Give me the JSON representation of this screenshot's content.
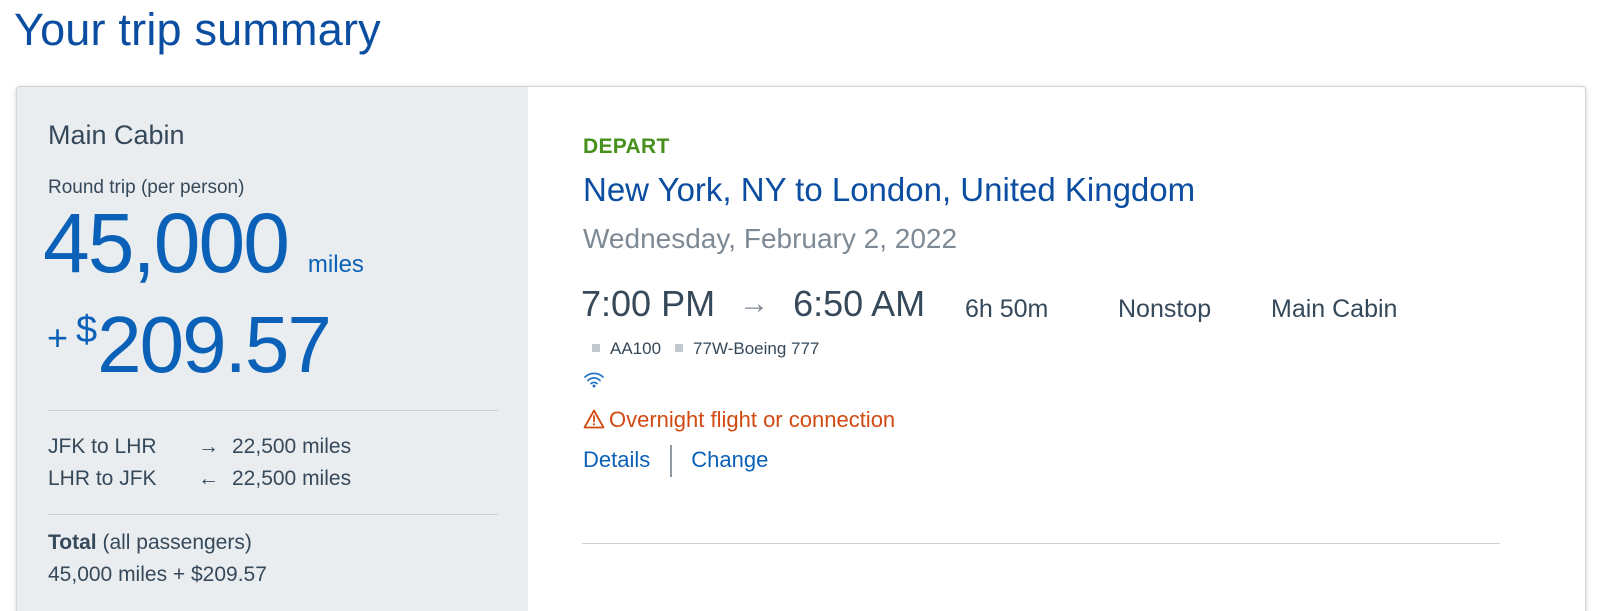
{
  "page": {
    "title": "Your trip summary"
  },
  "summary": {
    "cabin": "Main Cabin",
    "trip_type": "Round trip (per person)",
    "miles_amount": "45,000",
    "miles_unit": "miles",
    "price_plus": "+",
    "price_currency": "$",
    "price_amount": "209.57",
    "segments": [
      {
        "route": "JFK to LHR",
        "arrow": "→",
        "miles": "22,500 miles"
      },
      {
        "route": "LHR to JFK",
        "arrow": "←",
        "miles": "22,500 miles"
      }
    ],
    "total_label": "Total",
    "total_note": "(all passengers)",
    "total_value": "45,000 miles + $209.57"
  },
  "flight": {
    "direction_label": "DEPART",
    "route_title": "New York, NY to London, United Kingdom",
    "date": "Wednesday, February 2, 2022",
    "depart_time": "7:00 PM",
    "arrive_time": "6:50 AM",
    "duration": "6h 50m",
    "stops": "Nonstop",
    "cabin": "Main Cabin",
    "flight_number": "AA100",
    "aircraft": "77W-Boeing 777",
    "amenity_icon": "wifi-icon",
    "warning": "Overnight flight or connection",
    "details_link": "Details",
    "change_link": "Change"
  },
  "colors": {
    "title_blue": "#0b4da1",
    "price_blue": "#0b61b7",
    "depart_green": "#47901b",
    "warning_orange": "#d14a12",
    "summary_bg": "#e9edf0"
  }
}
